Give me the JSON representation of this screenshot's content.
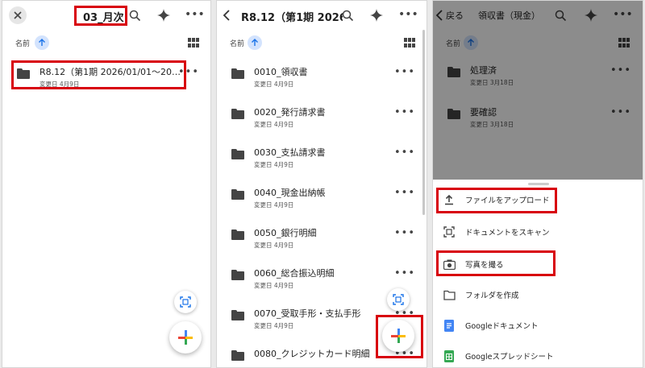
{
  "panel1": {
    "title": "03_月次",
    "sort_label": "名前",
    "items": [
      {
        "name": "R8.12（第1期 2026/01/01～2026/...",
        "meta": "変更日 4月9日"
      }
    ]
  },
  "panel2": {
    "title": "R8.12（第1期 2026...",
    "sort_label": "名前",
    "items": [
      {
        "name": "0010_領収書",
        "meta": "変更日 4月9日"
      },
      {
        "name": "0020_発行請求書",
        "meta": "変更日 4月9日"
      },
      {
        "name": "0030_支払請求書",
        "meta": "変更日 4月9日"
      },
      {
        "name": "0040_現金出納帳",
        "meta": "変更日 4月9日"
      },
      {
        "name": "0050_銀行明細",
        "meta": "変更日 4月9日"
      },
      {
        "name": "0060_総合振込明細",
        "meta": "変更日 4月9日"
      },
      {
        "name": "0070_受取手形・支払手形",
        "meta": "変更日 4月9日"
      },
      {
        "name": "0080_クレジットカード明細",
        "meta": ""
      }
    ]
  },
  "panel3": {
    "back_label": "戻る",
    "title": "領収書（現金）",
    "sort_label": "名前",
    "items": [
      {
        "name": "処理済",
        "meta": "変更日 3月18日"
      },
      {
        "name": "要確認",
        "meta": "変更日 3月18日"
      }
    ],
    "menu": [
      {
        "label": "ファイルをアップロード",
        "icon": "upload-icon"
      },
      {
        "label": "ドキュメントをスキャン",
        "icon": "scan-icon"
      },
      {
        "label": "写真を撮る",
        "icon": "camera-icon"
      },
      {
        "label": "フォルダを作成",
        "icon": "folder-outline-icon"
      },
      {
        "label": "Googleドキュメント",
        "icon": "google-docs-icon"
      },
      {
        "label": "Googleスプレッドシート",
        "icon": "google-sheets-icon"
      }
    ]
  },
  "colors": {
    "highlight": "#d8000c",
    "accent_blue": "#1a73e8",
    "sort_bg": "#d3e3fd",
    "plus_blue": "#4285f4",
    "plus_red": "#ea4335",
    "plus_yellow": "#fbbc04",
    "plus_green": "#34a853"
  }
}
